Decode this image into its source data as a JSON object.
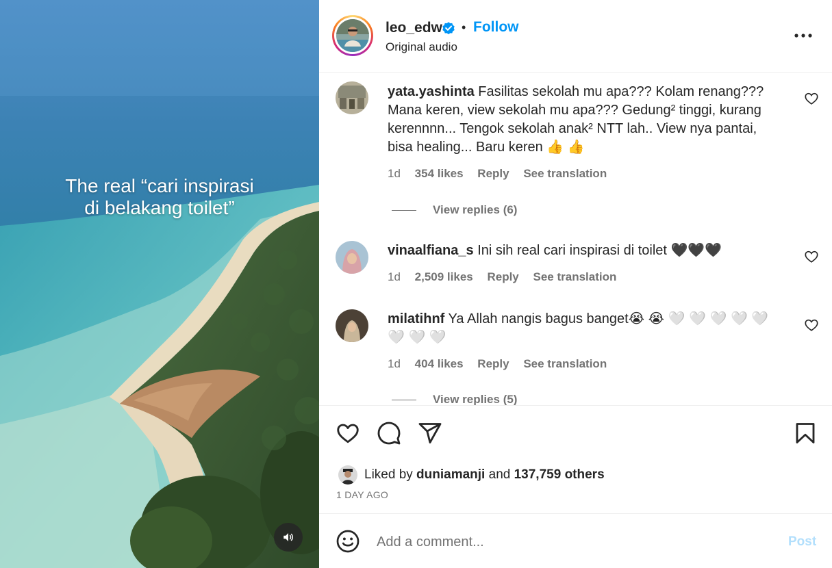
{
  "media": {
    "overlay_line1": "The real “cari inspirasi",
    "overlay_line2": "di belakang toilet”",
    "audio_icon": "speaker-icon"
  },
  "header": {
    "username": "leo_edw",
    "verified_icon": "verified-badge-icon",
    "separator": "•",
    "follow_label": "Follow",
    "audio_label": "Original audio",
    "more_icon": "more-options-icon"
  },
  "comments": [
    {
      "username": "yata.yashinta",
      "text": "Fasilitas sekolah mu apa??? Kolam renang??? Mana keren, view sekolah mu apa??? Gedung² tinggi, kurang kerennnn... Tengok sekolah anak² NTT lah.. View nya pantai, bisa healing... Baru keren 👍 👍",
      "time": "1d",
      "likes": "354 likes",
      "reply_label": "Reply",
      "translate_label": "See translation",
      "replies_label": "View replies (6)"
    },
    {
      "username": "vinaalfiana_s",
      "text": "Ini sih real cari inspirasi di toilet 🖤🖤🖤",
      "time": "1d",
      "likes": "2,509 likes",
      "reply_label": "Reply",
      "translate_label": "See translation"
    },
    {
      "username": "milatihnf",
      "text": "Ya Allah nangis bagus banget😭 😭 🤍 🤍 🤍 🤍 🤍 🤍 🤍 🤍",
      "time": "1d",
      "likes": "404 likes",
      "reply_label": "Reply",
      "translate_label": "See translation",
      "replies_label": "View replies (5)"
    }
  ],
  "actions": {
    "like_icon": "heart-icon",
    "comment_icon": "comment-bubble-icon",
    "share_icon": "send-icon",
    "save_icon": "bookmark-icon"
  },
  "likes": {
    "prefix": "Liked by ",
    "user": "duniamanji",
    "middle": " and ",
    "count": "137,759 others"
  },
  "time_ago": "1 DAY AGO",
  "comment_bar": {
    "emoji_icon": "emoji-smile-icon",
    "placeholder": "Add a comment...",
    "post_label": "Post"
  },
  "colors": {
    "accent": "#0095f6",
    "post_disabled": "#b2dffc",
    "secondary_text": "#737373",
    "primary_text": "#262626"
  }
}
